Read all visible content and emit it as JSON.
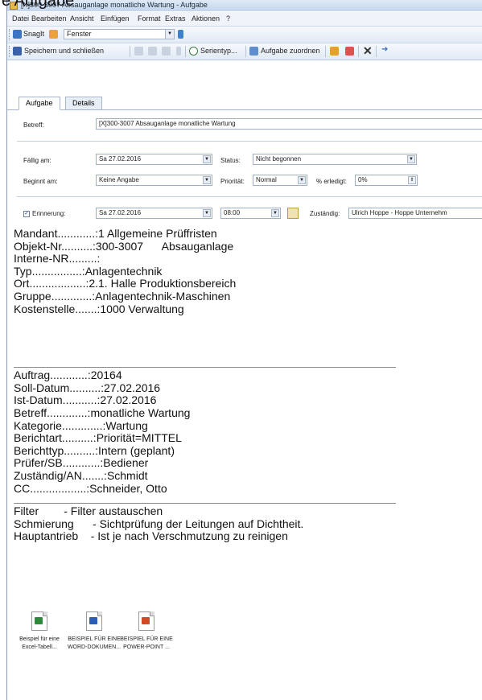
{
  "top_overlay_text": "e Aufgabe",
  "window": {
    "title": "[X]300-3007 Absauganlage monatliche Wartung - Aufgabe"
  },
  "menu": {
    "items": [
      "Datei",
      "Bearbeiten",
      "Ansicht",
      "Einfügen",
      "Format",
      "Extras",
      "Aktionen",
      "?"
    ]
  },
  "toolbar_snagit": {
    "snagit_label": "SnagIt",
    "window_combo": "Fenster"
  },
  "toolbar_main": {
    "save_close": "Speichern und schließen",
    "series_type": "Serientyp...",
    "assign_task": "Aufgabe zuordnen"
  },
  "tabs": {
    "task": "Aufgabe",
    "details": "Details"
  },
  "form": {
    "subject_label": "Betreff:",
    "subject_value": "[X]300-3007 Absauganlage monatliche Wartung",
    "due_label": "Fällig am:",
    "due_value": "Sa 27.02.2016",
    "start_label": "Beginnt am:",
    "start_value": "Keine Angabe",
    "status_label": "Status:",
    "status_value": "Nicht begonnen",
    "priority_label": "Priorität:",
    "priority_value": "Normal",
    "percent_label": "% erledigt:",
    "percent_value": "0%",
    "reminder_label": "Erinnerung:",
    "reminder_checked": true,
    "reminder_date": "Sa 27.02.2016",
    "reminder_time": "08:00",
    "owner_label": "Zuständig:",
    "owner_value": "Ulrich Hoppe - Hoppe Unternehm"
  },
  "body": {
    "block1": [
      "Mandant............:1 Allgemeine Prüffristen",
      "Objekt-Nr..........:300-3007      Absauganlage",
      "Interne-NR.........:",
      "Typ................:Anlagentechnik",
      "Ort..................:2.1. Halle Produktionsbereich",
      "Gruppe.............:Anlagentechnik-Maschinen",
      "Kostenstelle.......:1000 Verwaltung"
    ],
    "block2": [
      "Auftrag............:20164",
      "Soll-Datum..........:27.02.2016",
      "Ist-Datum...........:27.02.2016",
      "Betreff.............:monatliche Wartung",
      "Kategorie.............:Wartung",
      "Berichtart..........:Priorität=MITTEL",
      "Berichttyp..........:Intern (geplant)",
      "Prüfer/SB............:Bediener",
      "Zuständig/AN.......:Schmidt",
      "CC..................:Schneider, Otto"
    ],
    "block3": [
      "Filter        - Filter austauschen",
      "Schmierung      - Sichtprüfung der Leitungen auf Dichtheit.",
      "Hauptantrieb    - Ist je nach Verschmutzung zu reinigen"
    ]
  },
  "attachments": [
    {
      "line1": "Beispiel für eine",
      "line2": "Excel-Tabell...",
      "color": "#2e8b3a",
      "icon": "excel-icon"
    },
    {
      "line1": "BEISPIEL FÜR EINE",
      "line2": "WORD-DOKUMEN...",
      "color": "#2b5cb8",
      "icon": "word-icon"
    },
    {
      "line1": "BEISPIEL FÜR EINE",
      "line2": "POWER-POINT ...",
      "color": "#d24a26",
      "icon": "powerpoint-icon"
    }
  ]
}
